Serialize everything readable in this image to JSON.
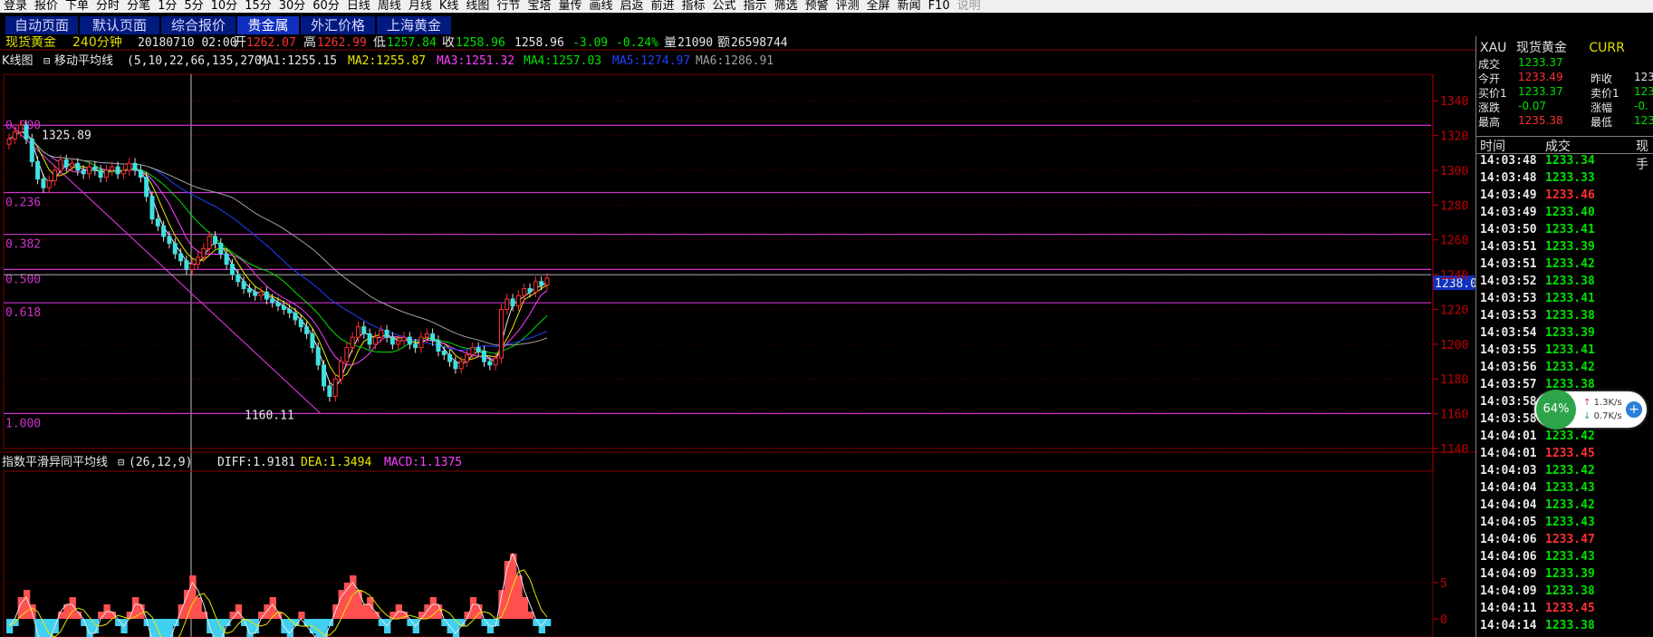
{
  "menubar": {
    "items": [
      "登录",
      "报价",
      "下单",
      "分时",
      "分笔",
      "1分",
      "5分",
      "10分",
      "15分",
      "30分",
      "60分",
      "日线",
      "周线",
      "月线",
      "K线",
      "线图",
      "行节",
      "宝塔",
      "量传",
      "画线",
      "启返",
      "前进",
      "指标",
      "公式",
      "指示",
      "筛选",
      "预警",
      "评测",
      "全屏",
      "新闻",
      "F10",
      "说明"
    ]
  },
  "tabs": [
    {
      "label": "自动页面"
    },
    {
      "label": "默认页面"
    },
    {
      "label": "综合报价"
    },
    {
      "label": "贵金属",
      "active": true
    },
    {
      "label": "外汇价格"
    },
    {
      "label": "上海黄金"
    }
  ],
  "header": {
    "name": "现货黄金",
    "period": "240分钟",
    "datetime": "20180710 02:00",
    "open_label": "开",
    "open": "1262.07",
    "high_label": "高",
    "high": "1262.99",
    "low_label": "低",
    "low": "1257.84",
    "close_label": "收",
    "close": "1258.96",
    "last": "1258.96",
    "change": "-3.09",
    "change_pct": "-0.24%",
    "volume_label": "量",
    "volume": "21090",
    "amount_label": "额",
    "amount": "26598744"
  },
  "ma_legend": {
    "title": "K线图",
    "indicator": "移动平均线",
    "params": "(5,10,22,66,135,270)",
    "items": [
      {
        "label": "MA1:1255.15",
        "color": "#e8e8e8"
      },
      {
        "label": "MA2:1255.87",
        "color": "#e8e800"
      },
      {
        "label": "MA3:1251.32",
        "color": "#ff40ff"
      },
      {
        "label": "MA4:1257.03",
        "color": "#00e000"
      },
      {
        "label": "MA5:1274.97",
        "color": "#2040ff"
      },
      {
        "label": "MA6:1286.91",
        "color": "#a0a0a0"
      }
    ]
  },
  "macd_legend": {
    "title": "指数平滑异同平均线",
    "params": "(26,12,9)",
    "items": [
      {
        "label": "DIFF:1.9181",
        "color": "#e8e8e8"
      },
      {
        "label": "DEA:1.3494",
        "color": "#e8e800"
      },
      {
        "label": "MACD:1.1375",
        "color": "#ff40ff"
      }
    ]
  },
  "fib": {
    "levels": [
      {
        "label": "0.000",
        "value": 1325.89
      },
      {
        "label": "0.236",
        "value": 1287.2
      },
      {
        "label": "0.382",
        "value": 1263.2
      },
      {
        "label": "0.500",
        "value": 1243.0
      },
      {
        "label": "0.618",
        "value": 1223.8
      },
      {
        "label": "1.000",
        "value": 1160.11
      }
    ],
    "high_label": "1325.89",
    "low_label": "1160.11"
  },
  "chart_data": {
    "type": "candlestick",
    "y_ticks": [
      "1340",
      "1320",
      "1300",
      "1280",
      "1260",
      "1240",
      "1220",
      "1200",
      "1180",
      "1160",
      "1140"
    ],
    "ylim": [
      1140,
      1350
    ],
    "current_price_label": "1238.0",
    "close_series": [
      1318,
      1322,
      1326,
      1318,
      1305,
      1295,
      1290,
      1294,
      1300,
      1306,
      1302,
      1304,
      1300,
      1298,
      1302,
      1300,
      1296,
      1300,
      1302,
      1298,
      1300,
      1304,
      1300,
      1296,
      1285,
      1272,
      1268,
      1262,
      1258,
      1252,
      1248,
      1243,
      1246,
      1250,
      1255,
      1262,
      1258,
      1252,
      1246,
      1240,
      1236,
      1232,
      1230,
      1228,
      1230,
      1226,
      1224,
      1222,
      1220,
      1218,
      1214,
      1210,
      1206,
      1198,
      1188,
      1176,
      1170,
      1180,
      1190,
      1198,
      1204,
      1210,
      1206,
      1200,
      1204,
      1208,
      1204,
      1200,
      1202,
      1204,
      1200,
      1198,
      1204,
      1206,
      1202,
      1196,
      1194,
      1190,
      1186,
      1190,
      1194,
      1198,
      1196,
      1190,
      1188,
      1192,
      1220,
      1226,
      1222,
      1228,
      1232,
      1230,
      1236,
      1234,
      1238
    ],
    "macd_ticks": [
      "5",
      "0"
    ],
    "macd_hist": [
      -2,
      -1,
      3,
      4,
      2,
      -3,
      -5,
      -4,
      -2,
      1,
      2,
      3,
      1,
      -1,
      -3,
      -2,
      1,
      2,
      1,
      -1,
      -2,
      1,
      3,
      2,
      -1,
      -4,
      -6,
      -5,
      -3,
      -1,
      2,
      4,
      6,
      3,
      1,
      -2,
      -4,
      -3,
      -1,
      1,
      2,
      -1,
      -3,
      -2,
      1,
      2,
      3,
      1,
      -2,
      -3,
      -1,
      1,
      -1,
      -2,
      -4,
      -3,
      -1,
      2,
      4,
      5,
      6,
      4,
      2,
      3,
      1,
      -1,
      -2,
      1,
      2,
      1,
      -1,
      -2,
      1,
      2,
      3,
      2,
      -1,
      -2,
      -3,
      -1,
      1,
      3,
      2,
      -1,
      -2,
      -1,
      4,
      8,
      9,
      6,
      3,
      1,
      -1,
      -2,
      -1
    ],
    "dif_series": [
      -1,
      0,
      2,
      3,
      1,
      -2,
      -4,
      -3,
      -1,
      1,
      2,
      2,
      1,
      0,
      -2,
      -2,
      0,
      1,
      1,
      0,
      -1,
      0,
      2,
      2,
      0,
      -3,
      -5,
      -5,
      -3,
      -1,
      1,
      3,
      5,
      4,
      2,
      -1,
      -3,
      -3,
      -1,
      0,
      1,
      0,
      -2,
      -2,
      0,
      1,
      2,
      1,
      -1,
      -2,
      -1,
      0,
      -1,
      -2,
      -3,
      -3,
      -1,
      1,
      3,
      4,
      5,
      4,
      2,
      2,
      1,
      0,
      -1,
      0,
      1,
      1,
      0,
      -1,
      0,
      1,
      2,
      2,
      0,
      -1,
      -2,
      -1,
      0,
      2,
      2,
      0,
      -1,
      -1,
      3,
      7,
      9,
      7,
      4,
      2,
      0,
      -1,
      0
    ]
  },
  "right_panel": {
    "code": "XAU",
    "name": "现货黄金",
    "market": "CURR",
    "quote_rows": [
      {
        "l1": "成交",
        "v1": "1233.37",
        "c1": "#00e000",
        "l2": "",
        "v2": "",
        "c2": ""
      },
      {
        "l1": "今开",
        "v1": "1233.49",
        "c1": "#ff3030",
        "l2": "昨收",
        "v2": "123",
        "c2": "#e8e8e8"
      },
      {
        "l1": "买价1",
        "v1": "1233.37",
        "c1": "#00e000",
        "l2": "卖价1",
        "v2": "123",
        "c2": "#00e000"
      },
      {
        "l1": "涨跌",
        "v1": "-0.07",
        "c1": "#00e000",
        "l2": "涨幅",
        "v2": "-0.",
        "c2": "#00e000"
      },
      {
        "l1": "最高",
        "v1": "1235.38",
        "c1": "#ff3030",
        "l2": "最低",
        "v2": "123",
        "c2": "#00e000"
      }
    ],
    "tick_headers": {
      "time": "时间",
      "price": "成交",
      "now": "现手"
    },
    "ticks": [
      {
        "time": "14:03:48",
        "price": "1233.34",
        "color": "#00e000"
      },
      {
        "time": "14:03:48",
        "price": "1233.33",
        "color": "#00e000"
      },
      {
        "time": "14:03:49",
        "price": "1233.46",
        "color": "#ff3030"
      },
      {
        "time": "14:03:49",
        "price": "1233.40",
        "color": "#00e000"
      },
      {
        "time": "14:03:50",
        "price": "1233.41",
        "color": "#00e000"
      },
      {
        "time": "14:03:51",
        "price": "1233.39",
        "color": "#00e000"
      },
      {
        "time": "14:03:51",
        "price": "1233.42",
        "color": "#00e000"
      },
      {
        "time": "14:03:52",
        "price": "1233.38",
        "color": "#00e000"
      },
      {
        "time": "14:03:53",
        "price": "1233.41",
        "color": "#00e000"
      },
      {
        "time": "14:03:53",
        "price": "1233.38",
        "color": "#00e000"
      },
      {
        "time": "14:03:54",
        "price": "1233.39",
        "color": "#00e000"
      },
      {
        "time": "14:03:55",
        "price": "1233.41",
        "color": "#00e000"
      },
      {
        "time": "14:03:56",
        "price": "1233.42",
        "color": "#00e000"
      },
      {
        "time": "14:03:57",
        "price": "1233.38",
        "color": "#00e000"
      },
      {
        "time": "14:03:58",
        "price": "1233.38",
        "color": "#00e000"
      },
      {
        "time": "14:03:58",
        "price": "1233.38",
        "color": "#00e000"
      },
      {
        "time": "14:04:01",
        "price": "1233.42",
        "color": "#00e000"
      },
      {
        "time": "14:04:01",
        "price": "1233.45",
        "color": "#ff3030"
      },
      {
        "time": "14:04:03",
        "price": "1233.42",
        "color": "#00e000"
      },
      {
        "time": "14:04:04",
        "price": "1233.43",
        "color": "#00e000"
      },
      {
        "time": "14:04:04",
        "price": "1233.42",
        "color": "#00e000"
      },
      {
        "time": "14:04:05",
        "price": "1233.43",
        "color": "#00e000"
      },
      {
        "time": "14:04:06",
        "price": "1233.47",
        "color": "#ff3030"
      },
      {
        "time": "14:04:06",
        "price": "1233.43",
        "color": "#00e000"
      },
      {
        "time": "14:04:09",
        "price": "1233.39",
        "color": "#00e000"
      },
      {
        "time": "14:04:09",
        "price": "1233.38",
        "color": "#00e000"
      },
      {
        "time": "14:04:11",
        "price": "1233.45",
        "color": "#ff3030"
      },
      {
        "time": "14:04:14",
        "price": "1233.38",
        "color": "#00e000"
      }
    ]
  },
  "speed_widget": {
    "percent": "64%",
    "upload": "1.3K/s",
    "download": "0.7K/s",
    "up_arrow": "↑",
    "down_arrow": "↓",
    "plus": "+"
  },
  "colors": {
    "red": "#ff3030",
    "green": "#00e000",
    "fib": "#cc33cc",
    "grid": "#800000",
    "axis": "#c00000"
  }
}
